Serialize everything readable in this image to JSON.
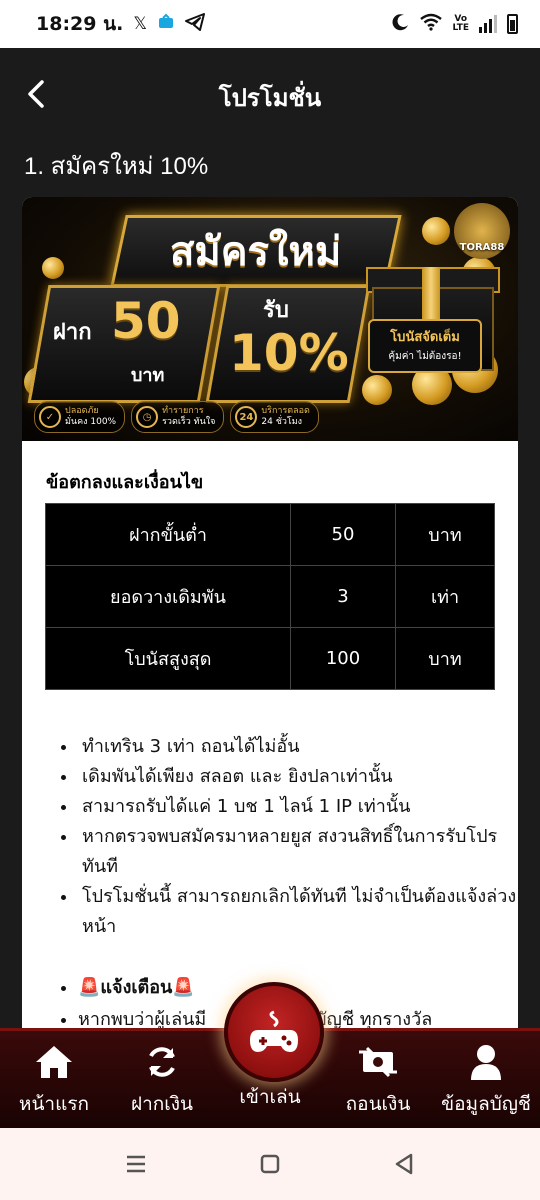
{
  "status": {
    "time": "18:29 น.",
    "lte_top": "Vo",
    "lte_bottom": "LTE"
  },
  "header": {
    "title": "โปรโมชั่น"
  },
  "promo": {
    "heading": "1. สมัครใหม่ 10%",
    "banner": {
      "title": "สมัครใหม่",
      "logo": "TORA88",
      "deposit_label": "ฝาก",
      "deposit_amount": "50",
      "deposit_unit": "บาท",
      "receive_label": "รับ",
      "receive_percent": "10%",
      "gift_tag_line1": "โบนัสจัดเต็ม",
      "gift_tag_line2": "คุ้มค่า ไม่ต้องรอ!",
      "features": [
        {
          "line1": "ปลอดภัย",
          "line2": "มั่นคง 100%"
        },
        {
          "line1": "ทำรายการ",
          "line2": "รวดเร็ว ทันใจ"
        },
        {
          "line1": "บริการตลอด",
          "line2": "24 ชั่วโมง",
          "badge": "24"
        }
      ]
    },
    "terms_title": "ข้อตกลงและเงื่อนไข",
    "terms_rows": [
      {
        "label": "ฝากขั้นต่ำ",
        "value": "50",
        "unit": "บาท"
      },
      {
        "label": "ยอดวางเดิมพัน",
        "value": "3",
        "unit": "เท่า"
      },
      {
        "label": "โบนัสสูงสุด",
        "value": "100",
        "unit": "บาท"
      }
    ],
    "rules": [
      "ทำเทริน 3 เท่า ถอนได้ไม่อั้น",
      "เดิมพันได้เพียง สลอต และ ยิงปลาเท่านั้น",
      "สามารถรับได้แค่ 1 บช 1 ไลน์ 1 IP เท่านั้น",
      "หากตรวจพบสมัครมาหลายยูส สงวนสิทธิ์ในการรับโปรทันที",
      "โปรโมชั่นนี้ สามารถยกเลิกได้ทันที ไม่จำเป็นต้องแจ้งล่วงหน้า"
    ],
    "warning_title": "แจ้งเตือน",
    "warning_line": "หากพบว่าผู้เล่นมี",
    "warning_tail": "งบัญชี ทุกรางวัล"
  },
  "nav": {
    "home": "หน้าแรก",
    "deposit": "ฝากเงิน",
    "play": "เข้าเล่น",
    "withdraw": "ถอนเงิน",
    "account": "ข้อมูลบัญชี"
  },
  "colors": {
    "gold": "#d8a93a",
    "nav_red": "#7a0707",
    "bg": "#1b1b1b"
  }
}
